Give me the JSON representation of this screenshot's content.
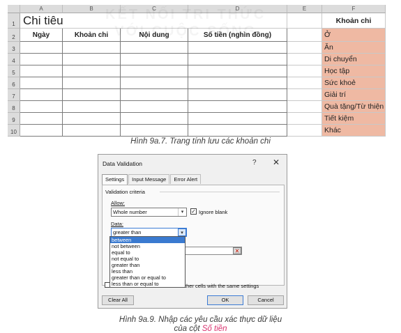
{
  "sheet": {
    "columns": [
      "A",
      "B",
      "C",
      "D",
      "E",
      "F"
    ],
    "row_numbers": [
      "1",
      "2",
      "3",
      "4",
      "5",
      "6",
      "7",
      "8",
      "9",
      "10"
    ],
    "title": "Chi tiêu",
    "headers": [
      "Ngày",
      "Khoản chi",
      "Nội dung",
      "Số tiền (nghìn đồng)"
    ],
    "watermark_line1": "KẾT NỐI TRI THỨC",
    "watermark_line2": "VỚI CUỘC SỐNG",
    "categories_header": "Khoản chi",
    "categories": [
      "Ở",
      "Ăn",
      "Di chuyển",
      "Học tập",
      "Sức khoẻ",
      "Giải trí",
      "Quà tặng/Từ thiện",
      "Tiết kiệm",
      "Khác"
    ],
    "category_color": "#efb9a3"
  },
  "caption1": "Hình 9a.7. Trang tính lưu các khoản chi",
  "dialog": {
    "title": "Data Validation",
    "help": "?",
    "close": "✕",
    "tabs": [
      "Settings",
      "Input Message",
      "Error Alert"
    ],
    "criteria_label": "Validation criteria",
    "allow_label": "Allow:",
    "allow_value": "Whole number",
    "ignore_blank_label": "Ignore blank",
    "ignore_blank_checked": "✓",
    "data_label": "Data:",
    "data_value": "greater than",
    "options": [
      "between",
      "not between",
      "equal to",
      "not equal to",
      "greater than",
      "less than",
      "greater than or equal to",
      "less than or equal to"
    ],
    "apply_text": "ther cells with the same settings",
    "clear_all": "Clear All",
    "ok": "OK",
    "cancel": "Cancel",
    "accent": "#3a7ad0"
  },
  "caption2": {
    "line1": "Hình 9a.9. Nhập các yêu cầu xác thực dữ liệu",
    "line2_prefix": "của cột ",
    "line2_emph": "Số tiền"
  }
}
